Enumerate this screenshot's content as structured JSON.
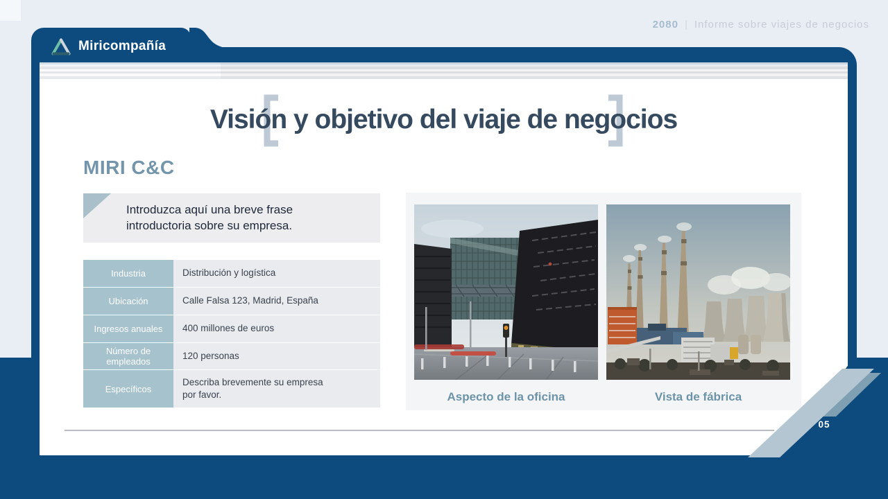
{
  "page_header": {
    "year": "2080",
    "separator": "|",
    "report_title": "Informe sobre viajes de negocios"
  },
  "brand": {
    "name": "Miricompañía"
  },
  "slide": {
    "title": "Visión y objetivo del viaje de negocios",
    "company_heading": "MIRI C&C",
    "intro_text": "Introduzca aquí una breve frase introductoria sobre su empresa.",
    "company_table": {
      "rows": [
        {
          "label": "Industria",
          "value": "Distribución y logística"
        },
        {
          "label": "Ubicación",
          "value": "Calle Falsa 123, Madrid, España"
        },
        {
          "label": "Ingresos anuales",
          "value": "400 millones de euros"
        },
        {
          "label": "Número de empleados",
          "value": "120 personas"
        },
        {
          "label": "Específicos",
          "value": "Describa brevemente su empresa por favor."
        }
      ]
    },
    "photos": [
      {
        "caption": "Aspecto de la oficina"
      },
      {
        "caption": "Vista de fábrica"
      }
    ],
    "page_number": "05"
  },
  "colors": {
    "navy": "#0d4b7e",
    "light_background": "#e9eef5",
    "accent_steel": "#7295ab",
    "table_label_bg": "#a5c2cd",
    "stripe_light": "#b3c6d2",
    "stripe_steel": "#7fa0b2",
    "title_text": "#35495f"
  }
}
